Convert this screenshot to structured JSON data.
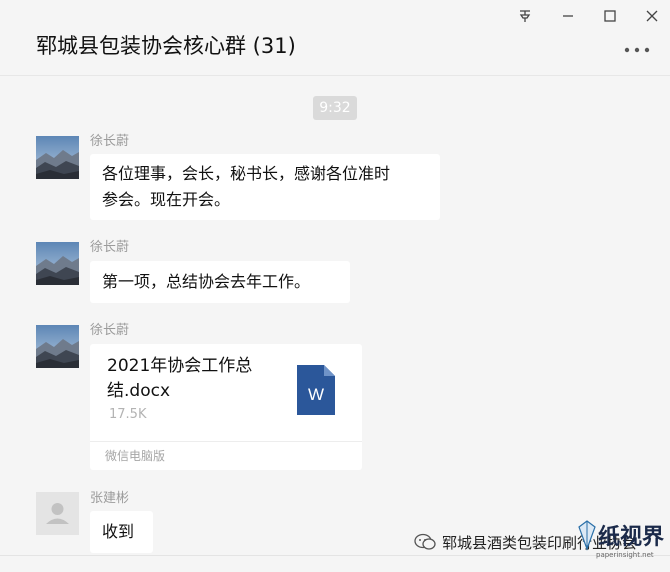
{
  "header": {
    "title": "郓城县包装协会核心群 (31)",
    "pin_icon": "pin-icon",
    "minimize_icon": "minimize-icon",
    "maximize_icon": "maximize-icon",
    "close_icon": "close-icon",
    "more_icon": "more-icon"
  },
  "chat": {
    "time": "9:32",
    "messages": [
      {
        "sender": "徐长蔚",
        "text": "各位理事，会长，秘书长，感谢各位准时参会。现在开会。",
        "lines": [
          "各位理事，会长，秘书长，感谢各位准时",
          "参会。现在开会。"
        ]
      },
      {
        "sender": "徐长蔚",
        "text": "第一项，总结协会去年工作。"
      },
      {
        "sender": "徐长蔚",
        "file": {
          "name": "2021年协会工作总结.docx",
          "name_lines": [
            "2021年协会工作总",
            "结.docx"
          ],
          "size": "17.5K",
          "source": "微信电脑版",
          "icon": "word-file-icon",
          "icon_letter": "W"
        }
      },
      {
        "sender": "张建彬",
        "text": "收到"
      }
    ]
  },
  "watermark": {
    "text": "郓城县酒类包装印刷行业协会",
    "logo_text": "纸视界",
    "logo_sub": "paperinsight.net"
  },
  "colors": {
    "background": "#f5f5f5",
    "bubble": "#ffffff",
    "word_blue": "#2b579a",
    "sender_gray": "#9b9b9b"
  }
}
